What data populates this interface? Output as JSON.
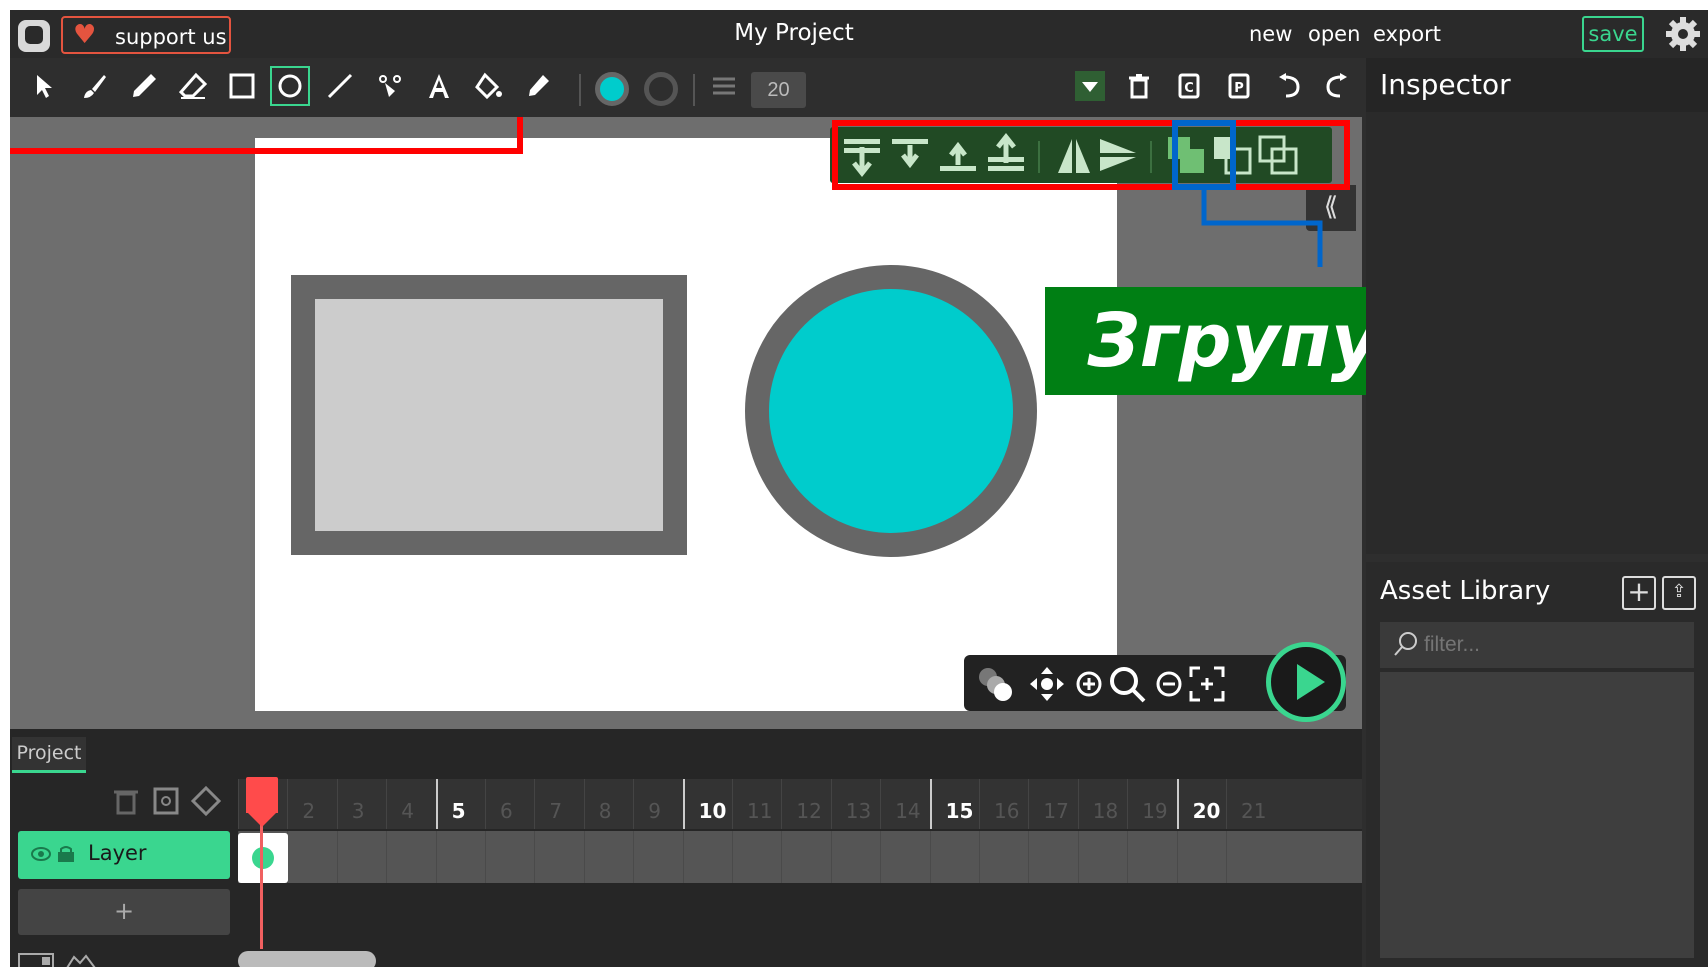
{
  "header": {
    "support_label": "support us",
    "title": "My Project",
    "menu": {
      "new": "new",
      "open": "open",
      "export": "export",
      "save": "save"
    }
  },
  "toolbar": {
    "stroke_width": "20",
    "tools": [
      "selection-tool",
      "brush-tool",
      "pencil-tool",
      "eraser-tool",
      "rectangle-tool",
      "ellipse-tool",
      "line-tool",
      "path-tool",
      "text-tool",
      "fill-tool",
      "eyedropper-tool"
    ],
    "active_tool": "ellipse-tool",
    "fill_color": "#00cccc",
    "stroke_color": "#666666"
  },
  "inspector": {
    "title": "Inspector"
  },
  "assets": {
    "title": "Asset Library",
    "filter_placeholder": "filter..."
  },
  "timeline": {
    "tab": "Project",
    "layer_name": "Layer",
    "add_layer": "+",
    "frames": [
      "",
      "2",
      "3",
      "4",
      "5",
      "6",
      "7",
      "8",
      "9",
      "10",
      "11",
      "12",
      "13",
      "14",
      "15",
      "16",
      "17",
      "18",
      "19",
      "20",
      "21"
    ],
    "major_frames": [
      "5",
      "10",
      "15",
      "20"
    ]
  },
  "annotation": {
    "label": "Згрупувати"
  },
  "colors": {
    "accent": "#3ad68f",
    "annotation_red": "#ff0000",
    "annotation_blue": "#0066cc",
    "annotation_green": "#007f14"
  }
}
